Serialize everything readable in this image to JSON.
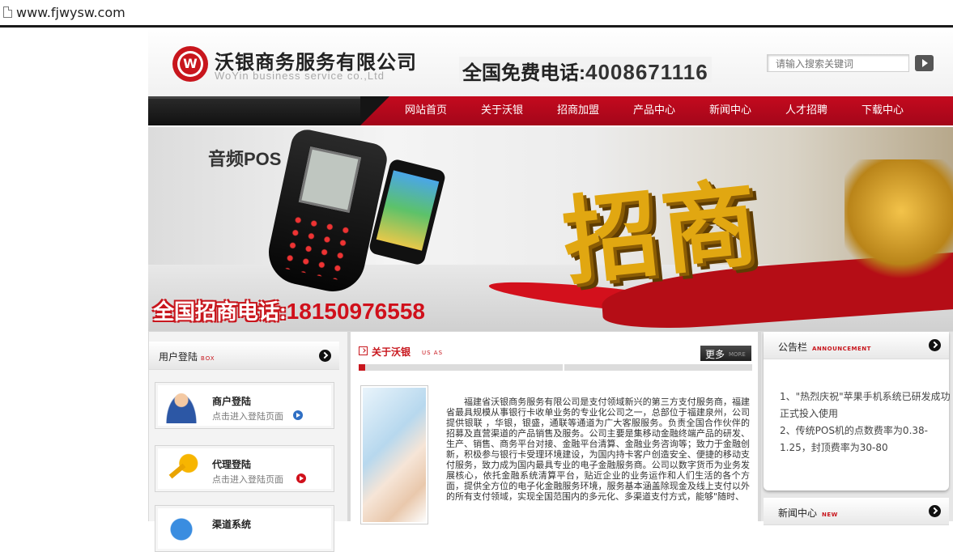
{
  "browser": {
    "url": "www.fjwysw.com"
  },
  "header": {
    "company_name": "沃银商务服务有限公司",
    "company_en": "WoYin business service co.,Ltd",
    "hotline_label": "全国免费电话:",
    "hotline_number": "4008671116",
    "search_placeholder": "请输入搜索关键词"
  },
  "nav": {
    "items": [
      "网站首页",
      "关于沃银",
      "招商加盟",
      "产品中心",
      "新闻中心",
      "人才招聘",
      "下载中心"
    ]
  },
  "banner": {
    "pos_label": "音频POS",
    "headline": "招商",
    "call_label": "全国招商电话:",
    "call_number": "18150976558"
  },
  "left_panel": {
    "title": "用户登陆",
    "sub": "BOX",
    "cards": [
      {
        "title": "商户登陆",
        "desc": "点击进入登陆页面",
        "icon": "user-icon",
        "accent": "#2f6fc4"
      },
      {
        "title": "代理登陆",
        "desc": "点击进入登陆页面",
        "icon": "key-icon",
        "accent": "#d0101b"
      },
      {
        "title": "渠道系统",
        "desc": "",
        "icon": "globe-icon",
        "accent": "#2f6fc4"
      }
    ]
  },
  "about": {
    "title": "关于沃银",
    "sub": "US AS",
    "more": "更多",
    "more_sub": "MORE",
    "text": "福建省沃银商务服务有限公司是支付领域新兴的第三方支付服务商，福建省最具规模从事银行卡收单业务的专业化公司之一，总部位于福建泉州，公司提供银联 ，华银，银盛，通联等通道为广大客服服务。负责全国合作伙伴的招募及直营渠道的产品销售及服务。公司主要是集移动金融终端产品的研发、生产、销售、商务平台对接、金融平台清算、金融业务咨询等；致力于金融创新，积极参与银行卡受理环境建设，为国内持卡客户创造安全、便捷的移动支付服务，致力成为国内最具专业的电子金融服务商。公司以数字货币为业务发展核心，依托金融系统清算平台，贴近企业的业务运作和人们生活的各个方面，提供全方位的电子化金融服务环境，服务基本涵盖除现金及线上支付以外的所有支付领域，实现全国范围内的多元化、多渠道支付方式，能够\"随时、"
  },
  "notice": {
    "title": "公告栏",
    "sub": "ANNOUNCEMENT",
    "items": [
      "1、\"热烈庆祝\"苹果手机系统已研发成功正式投入使用",
      "2、传统POS机的点数费率为0.38-1.25，封顶费率为30-80"
    ]
  },
  "news": {
    "title": "新闻中心",
    "sub": "NEW"
  },
  "colors": {
    "brand_red": "#c8161d",
    "nav_red": "#b80a1c",
    "dark": "#1a1a1a"
  }
}
